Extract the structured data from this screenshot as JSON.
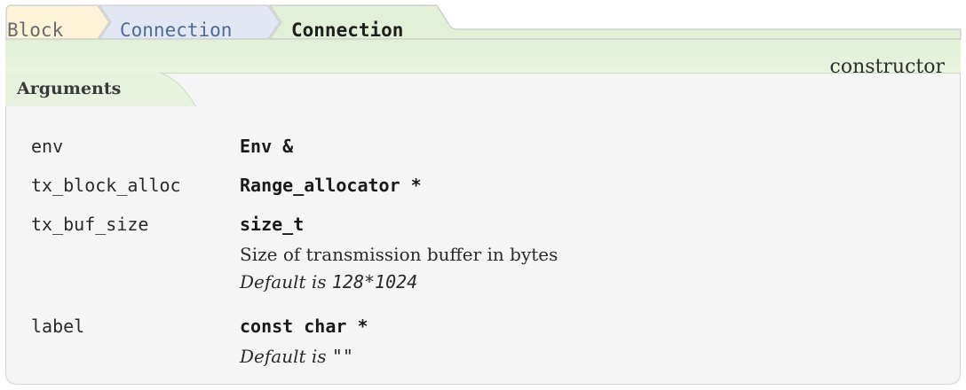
{
  "breadcrumb": [
    "Block",
    "Connection",
    "Connection"
  ],
  "kind": "constructor",
  "arguments_heading": "Arguments",
  "arguments": [
    {
      "name": "env",
      "type": "Env &"
    },
    {
      "name": "tx_block_alloc",
      "type": "Range_allocator *"
    },
    {
      "name": "tx_buf_size",
      "type": "size_t",
      "description": "Size of transmission buffer in bytes",
      "default_prefix": "Default is",
      "default_value": "128*1024"
    },
    {
      "name": "label",
      "type": "const char *",
      "default_prefix": "Default is",
      "default_value": "\"\""
    }
  ],
  "colors": {
    "crumb_block": "#fdf3d8",
    "crumb_connection": "#e1e8f3",
    "crumb_current": "#e3f0d8",
    "band": "#e6f2dc",
    "panel": "#f5f5f5"
  }
}
